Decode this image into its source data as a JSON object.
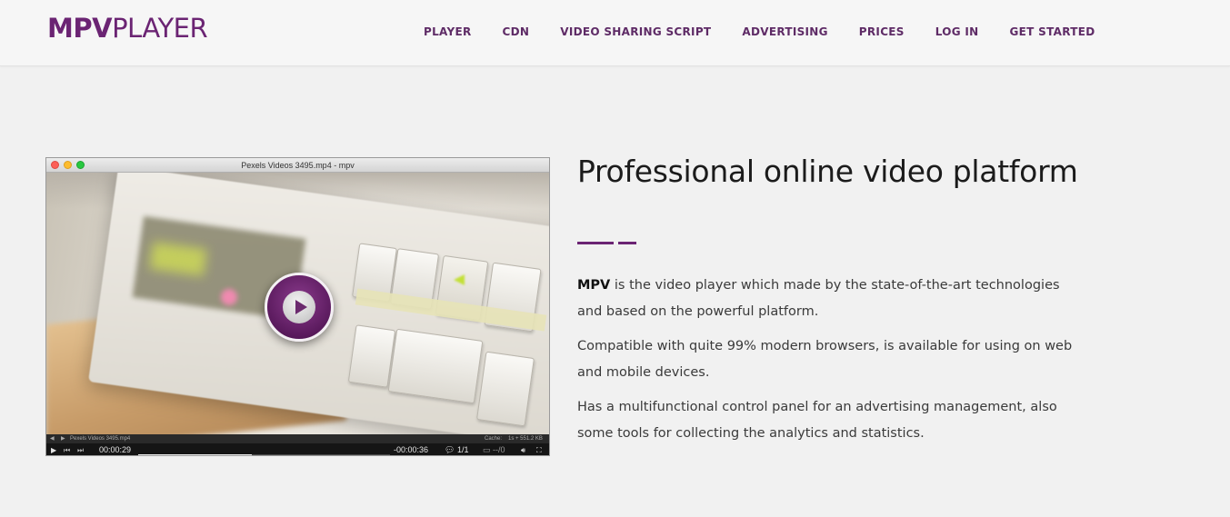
{
  "brand": {
    "logo_bold": "MPV",
    "logo_light": "PLAYER",
    "accent_color": "#6b2473"
  },
  "nav": {
    "items": [
      {
        "label": "PLAYER"
      },
      {
        "label": "CDN"
      },
      {
        "label": "VIDEO SHARING SCRIPT"
      },
      {
        "label": "ADVERTISING"
      },
      {
        "label": "PRICES"
      },
      {
        "label": "LOG IN"
      },
      {
        "label": "GET STARTED"
      }
    ]
  },
  "player": {
    "window_title": "Pexels Videos 3495.mp4 - mpv",
    "file_name": "Pexels Videos 3495.mp4",
    "cache_label": "Cache:",
    "cache_value": "1s + 551.2 KB",
    "elapsed": "00:00:29",
    "remaining": "-00:00:36",
    "progress": 0.45,
    "subtitles": "1/1",
    "audio": "--/0",
    "play_icon": "play-icon"
  },
  "hero": {
    "headline": "Professional online video platform",
    "p1_bold": "MPV",
    "p1_rest": " is the video player which made by the state-of-the-art technologies and based on the powerful platform.",
    "p2": "Compatible with quite 99% modern browsers, is available for using on web and mobile devices.",
    "p3": "Has a multifunctional control panel for an advertising management, also some tools for collecting the analytics and statistics."
  }
}
